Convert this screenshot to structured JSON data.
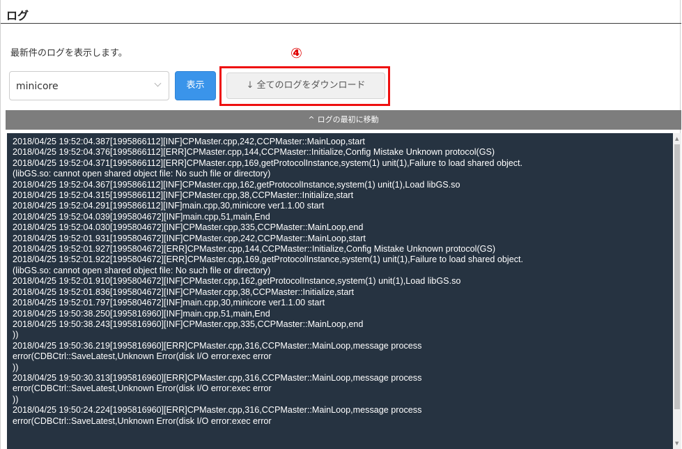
{
  "page": {
    "title": "ログ",
    "description": "最新件のログを表示します。",
    "callout": "④"
  },
  "controls": {
    "select_value": "minicore",
    "show_label": "表示",
    "download_icon": "↓",
    "download_label": "全てのログをダウンロード"
  },
  "jump_bar": {
    "caret": "^",
    "label": "ログの最初に移動"
  },
  "log": {
    "lines": [
      "2018/04/25 19:52:04.387[1995866112][INF]CPMaster.cpp,242,CCPMaster::MainLoop,start",
      "2018/04/25 19:52:04.376[1995866112][ERR]CPMaster.cpp,144,CCPMaster::Initialize,Config Mistake Unknown protocol(GS)",
      "2018/04/25 19:52:04.371[1995866112][ERR]CPMaster.cpp,169,getProtocolInstance,system(1) unit(1),Failure to load shared object.",
      "(libGS.so: cannot open shared object file: No such file or directory)",
      "2018/04/25 19:52:04.367[1995866112][INF]CPMaster.cpp,162,getProtocolInstance,system(1) unit(1),Load libGS.so",
      "2018/04/25 19:52:04.315[1995866112][INF]CPMaster.cpp,38,CCPMaster::Initialize,start",
      "2018/04/25 19:52:04.291[1995866112][INF]main.cpp,30,minicore ver1.1.00 start",
      "2018/04/25 19:52:04.039[1995804672][INF]main.cpp,51,main,End",
      "2018/04/25 19:52:04.030[1995804672][INF]CPMaster.cpp,335,CCPMaster::MainLoop,end",
      "2018/04/25 19:52:01.931[1995804672][INF]CPMaster.cpp,242,CCPMaster::MainLoop,start",
      "2018/04/25 19:52:01.927[1995804672][ERR]CPMaster.cpp,144,CCPMaster::Initialize,Config Mistake Unknown protocol(GS)",
      "2018/04/25 19:52:01.922[1995804672][ERR]CPMaster.cpp,169,getProtocolInstance,system(1) unit(1),Failure to load shared object.",
      "(libGS.so: cannot open shared object file: No such file or directory)",
      "2018/04/25 19:52:01.910[1995804672][INF]CPMaster.cpp,162,getProtocolInstance,system(1) unit(1),Load libGS.so",
      "2018/04/25 19:52:01.836[1995804672][INF]CPMaster.cpp,38,CCPMaster::Initialize,start",
      "2018/04/25 19:52:01.797[1995804672][INF]main.cpp,30,minicore ver1.1.00 start",
      "2018/04/25 19:50:38.250[1995816960][INF]main.cpp,51,main,End",
      "2018/04/25 19:50:38.243[1995816960][INF]CPMaster.cpp,335,CCPMaster::MainLoop,end",
      "))",
      "2018/04/25 19:50:36.219[1995816960][ERR]CPMaster.cpp,316,CCPMaster::MainLoop,message process",
      "error(CDBCtrl::SaveLatest,Unknown Error(disk I/O error:exec error",
      "))",
      "2018/04/25 19:50:30.313[1995816960][ERR]CPMaster.cpp,316,CCPMaster::MainLoop,message process",
      "error(CDBCtrl::SaveLatest,Unknown Error(disk I/O error:exec error",
      "))",
      "2018/04/25 19:50:24.224[1995816960][ERR]CPMaster.cpp,316,CCPMaster::MainLoop,message process",
      "error(CDBCtrl::SaveLatest,Unknown Error(disk I/O error:exec error"
    ],
    "scroll_up": "▲",
    "scroll_down": "▼"
  }
}
